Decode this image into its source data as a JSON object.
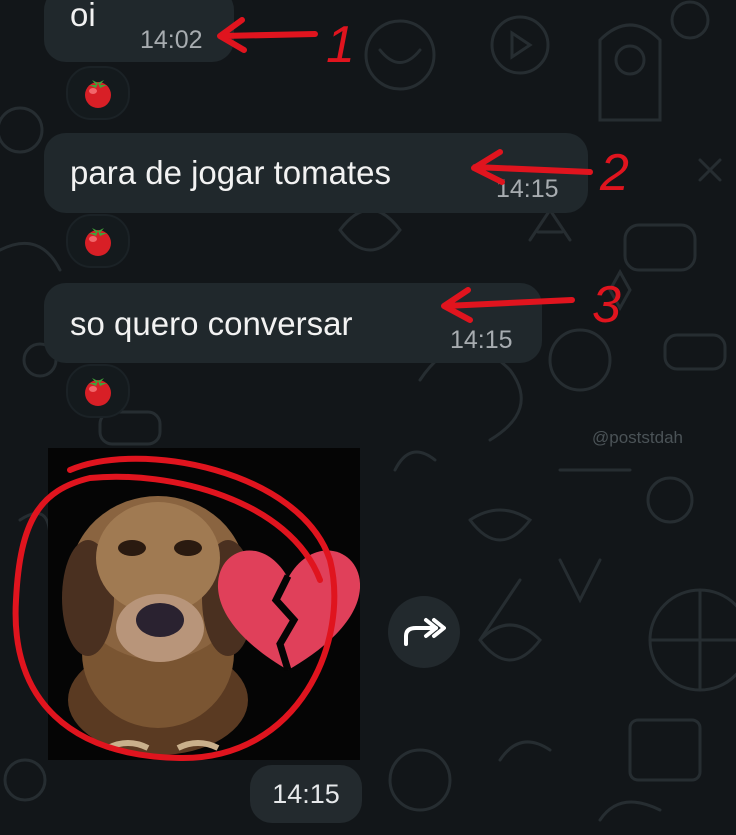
{
  "messages": [
    {
      "text": "oi",
      "time": "14:02",
      "reaction": "tomato"
    },
    {
      "text": "para de jogar tomates",
      "time": "14:15",
      "reaction": "tomato"
    },
    {
      "text": "so quero conversar",
      "time": "14:15",
      "reaction": "tomato"
    }
  ],
  "sticker": {
    "subject": "sad dachshund with broken heart",
    "time": "14:15"
  },
  "annotations": [
    "1",
    "2",
    "3"
  ],
  "watermark": "@poststdah",
  "colors": {
    "background": "#121619",
    "bubble": "#20282c",
    "time_text": "#a7acb0",
    "annotation": "#e0141e",
    "broken_heart": "#e0405a"
  }
}
